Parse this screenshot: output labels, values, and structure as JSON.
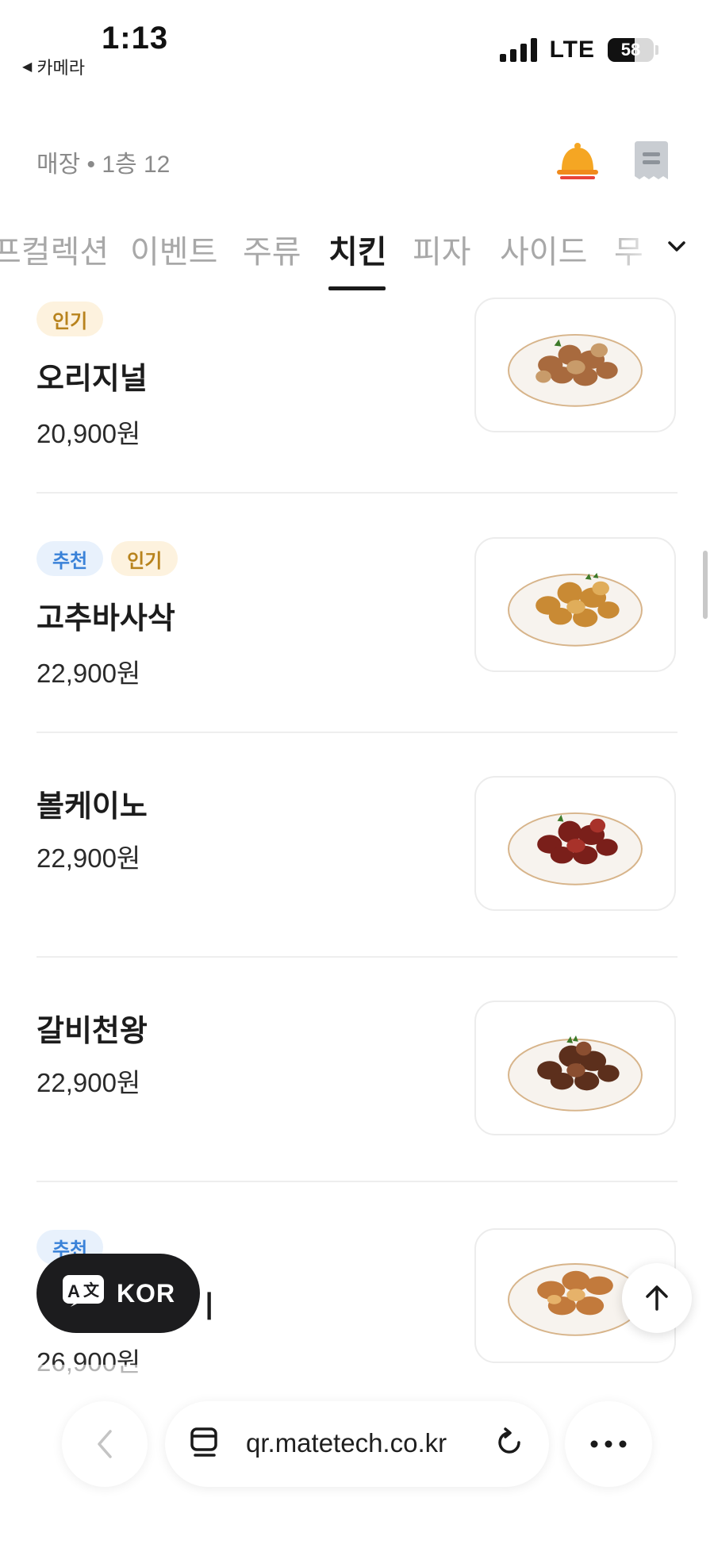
{
  "status_bar": {
    "time": "1:13",
    "back_app": "카메라",
    "network": "LTE",
    "battery": "58"
  },
  "header": {
    "store_label": "매장 • 1층 12",
    "bell_icon": "bell-icon",
    "receipt_icon": "receipt-icon"
  },
  "tabs": [
    {
      "label": "프컬렉션",
      "active": false
    },
    {
      "label": "이벤트",
      "active": false
    },
    {
      "label": "주류",
      "active": false
    },
    {
      "label": "치킨",
      "active": true
    },
    {
      "label": "피자",
      "active": false
    },
    {
      "label": "사이드",
      "active": false
    },
    {
      "label": "무",
      "active": false
    }
  ],
  "menu_items": [
    {
      "badges": [
        "인기"
      ],
      "name": "오리지널",
      "price": "20,900원",
      "image": "chicken-plate-original"
    },
    {
      "badges": [
        "추천",
        "인기"
      ],
      "name": "고추바사삭",
      "price": "22,900원",
      "image": "chicken-plate-gochu"
    },
    {
      "badges": [],
      "name": "볼케이노",
      "price": "22,900원",
      "image": "chicken-plate-volcano"
    },
    {
      "badges": [],
      "name": "갈비천왕",
      "price": "22,900원",
      "image": "chicken-plate-galbi"
    },
    {
      "badges": [
        "추천"
      ],
      "name": "",
      "price": "26,900원",
      "image": "chicken-plate-roasted"
    }
  ],
  "partial_name_suffix": "ㅣ",
  "floating": {
    "language_label": "KOR",
    "translate_icon": "translate-icon",
    "scroll_top_icon": "arrow-up-icon"
  },
  "browser": {
    "url": "qr.matetech.co.kr",
    "back_icon": "chevron-left-icon",
    "reader_icon": "reader-icon",
    "reload_icon": "reload-icon",
    "more_icon": "more-icon"
  },
  "colors": {
    "popular_badge_bg": "#fdf2de",
    "popular_badge_text": "#b8831d",
    "recommend_badge_bg": "#e8f1fc",
    "recommend_badge_text": "#3a82d8",
    "bell": "#f5a623"
  }
}
